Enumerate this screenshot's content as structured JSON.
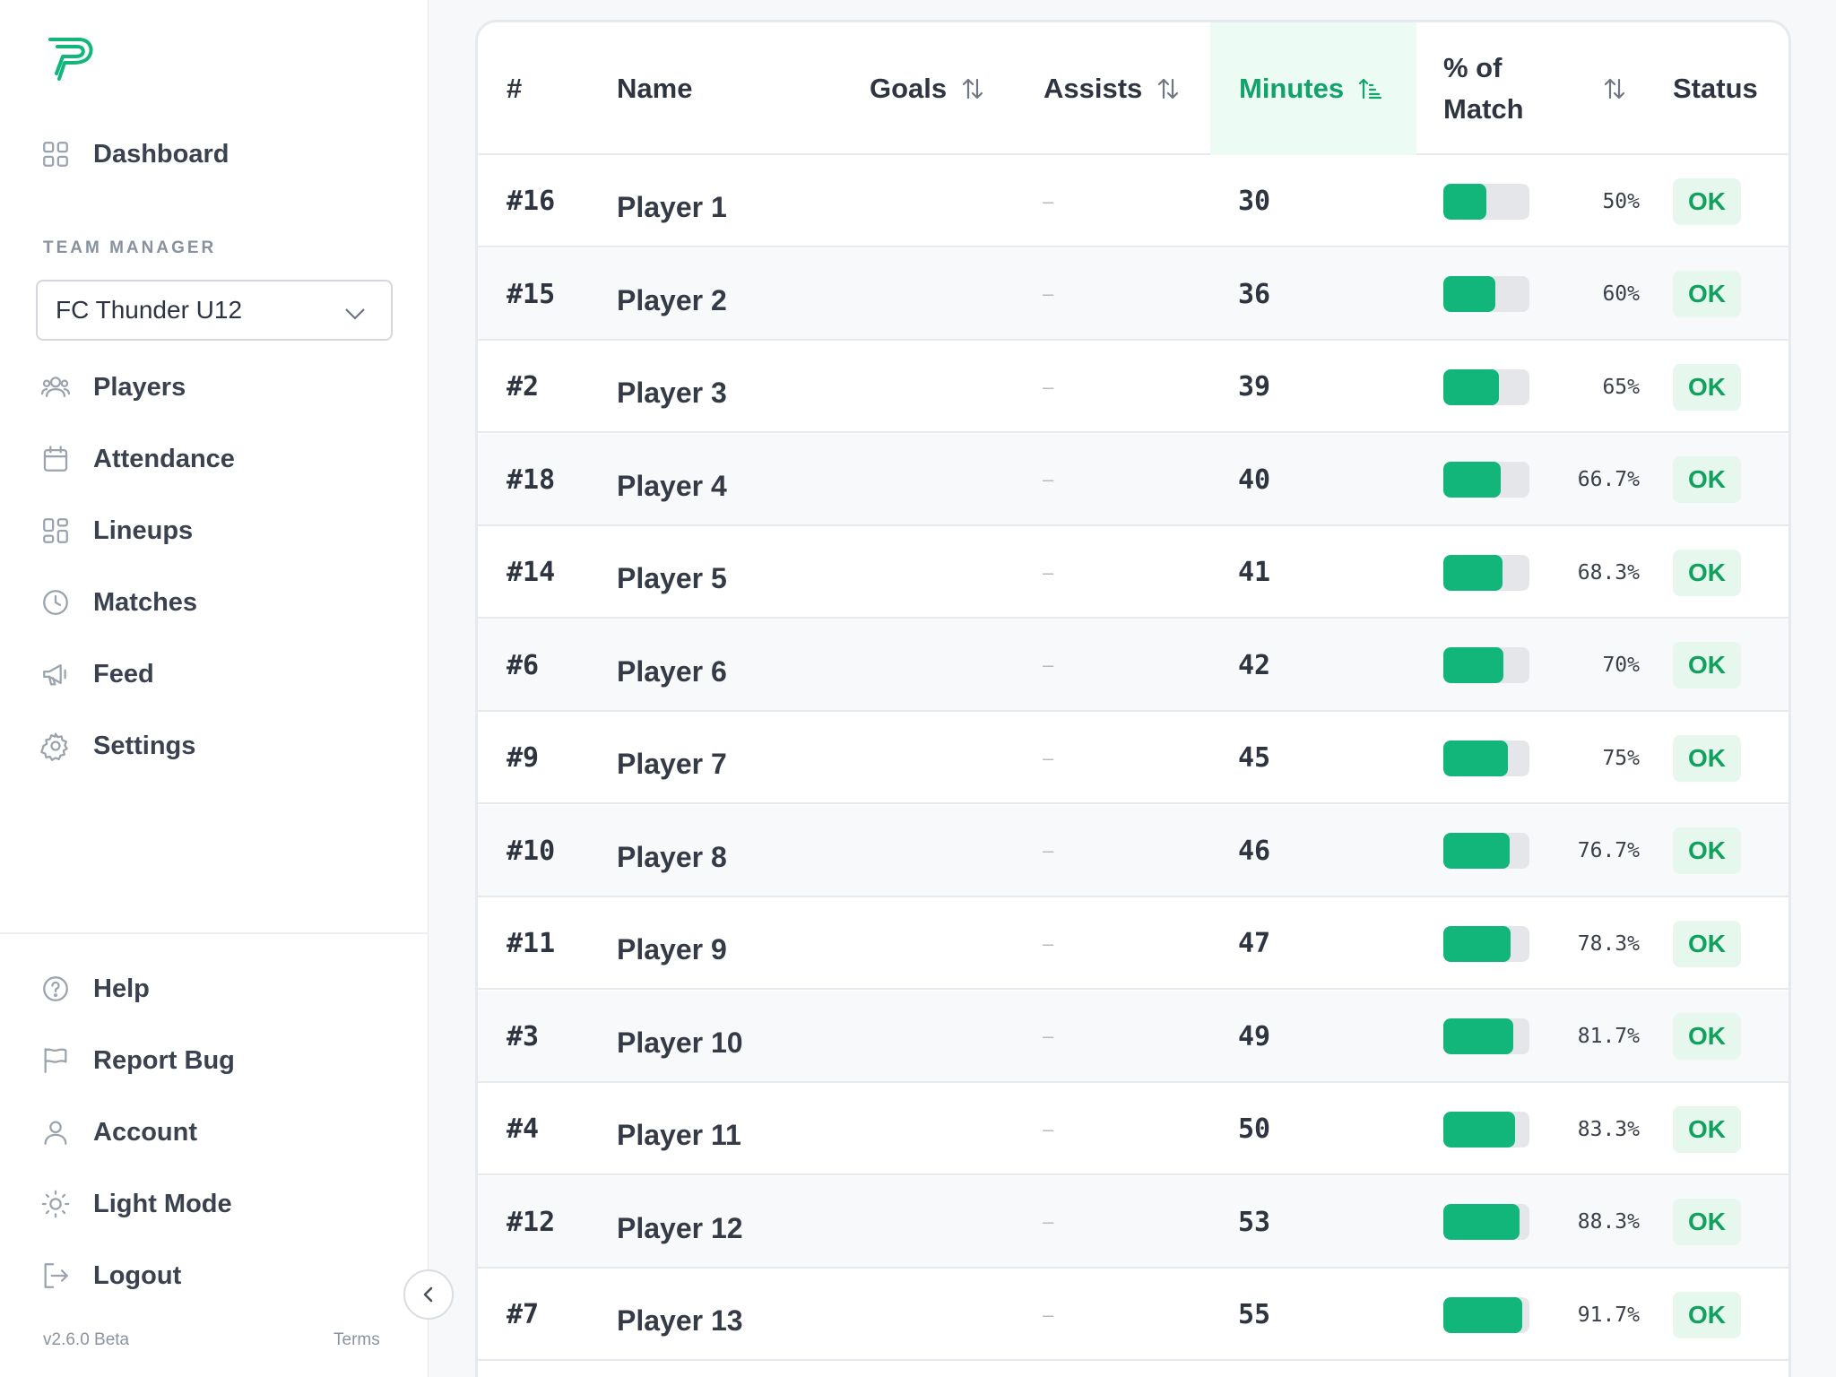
{
  "brand": {
    "accent": "#12b57a",
    "accent_dark": "#12a26b"
  },
  "sidebar": {
    "dashboard_label": "Dashboard",
    "section_label": "TEAM MANAGER",
    "team_select": {
      "value": "FC Thunder U12"
    },
    "items": [
      {
        "label": "Players",
        "icon": "users-icon"
      },
      {
        "label": "Attendance",
        "icon": "calendar-icon"
      },
      {
        "label": "Lineups",
        "icon": "layout-icon"
      },
      {
        "label": "Matches",
        "icon": "clock-icon"
      },
      {
        "label": "Feed",
        "icon": "megaphone-icon"
      },
      {
        "label": "Settings",
        "icon": "gear-icon"
      }
    ],
    "footer_items": [
      {
        "label": "Help",
        "icon": "help-icon"
      },
      {
        "label": "Report Bug",
        "icon": "flag-icon"
      },
      {
        "label": "Account",
        "icon": "user-icon"
      },
      {
        "label": "Light Mode",
        "icon": "sun-icon"
      },
      {
        "label": "Logout",
        "icon": "logout-icon"
      }
    ],
    "version": "v2.6.0 Beta",
    "terms": "Terms"
  },
  "table": {
    "headers": {
      "number": "#",
      "name": "Name",
      "goals": "Goals",
      "assists": "Assists",
      "minutes": "Minutes",
      "pct_line1": "% of",
      "pct_line2": "Match",
      "status": "Status"
    },
    "sorted_column": "minutes",
    "rows": [
      {
        "number": "#16",
        "name": "Player 1",
        "goals": "",
        "assists": "–",
        "minutes": "30",
        "pct": "50%",
        "fill": 0.5,
        "status": "OK"
      },
      {
        "number": "#15",
        "name": "Player 2",
        "goals": "",
        "assists": "–",
        "minutes": "36",
        "pct": "60%",
        "fill": 0.6,
        "status": "OK"
      },
      {
        "number": "#2",
        "name": "Player 3",
        "goals": "",
        "assists": "–",
        "minutes": "39",
        "pct": "65%",
        "fill": 0.65,
        "status": "OK"
      },
      {
        "number": "#18",
        "name": "Player 4",
        "goals": "",
        "assists": "–",
        "minutes": "40",
        "pct": "66.7%",
        "fill": 0.667,
        "status": "OK"
      },
      {
        "number": "#14",
        "name": "Player 5",
        "goals": "",
        "assists": "–",
        "minutes": "41",
        "pct": "68.3%",
        "fill": 0.683,
        "status": "OK"
      },
      {
        "number": "#6",
        "name": "Player 6",
        "goals": "",
        "assists": "–",
        "minutes": "42",
        "pct": "70%",
        "fill": 0.7,
        "status": "OK"
      },
      {
        "number": "#9",
        "name": "Player 7",
        "goals": "",
        "assists": "–",
        "minutes": "45",
        "pct": "75%",
        "fill": 0.75,
        "status": "OK"
      },
      {
        "number": "#10",
        "name": "Player 8",
        "goals": "",
        "assists": "–",
        "minutes": "46",
        "pct": "76.7%",
        "fill": 0.767,
        "status": "OK"
      },
      {
        "number": "#11",
        "name": "Player 9",
        "goals": "",
        "assists": "–",
        "minutes": "47",
        "pct": "78.3%",
        "fill": 0.783,
        "status": "OK"
      },
      {
        "number": "#3",
        "name": "Player 10",
        "goals": "",
        "assists": "–",
        "minutes": "49",
        "pct": "81.7%",
        "fill": 0.817,
        "status": "OK"
      },
      {
        "number": "#4",
        "name": "Player 11",
        "goals": "",
        "assists": "–",
        "minutes": "50",
        "pct": "83.3%",
        "fill": 0.833,
        "status": "OK"
      },
      {
        "number": "#12",
        "name": "Player 12",
        "goals": "",
        "assists": "–",
        "minutes": "53",
        "pct": "88.3%",
        "fill": 0.883,
        "status": "OK"
      },
      {
        "number": "#7",
        "name": "Player 13",
        "goals": "",
        "assists": "–",
        "minutes": "55",
        "pct": "91.7%",
        "fill": 0.917,
        "status": "OK"
      }
    ]
  }
}
